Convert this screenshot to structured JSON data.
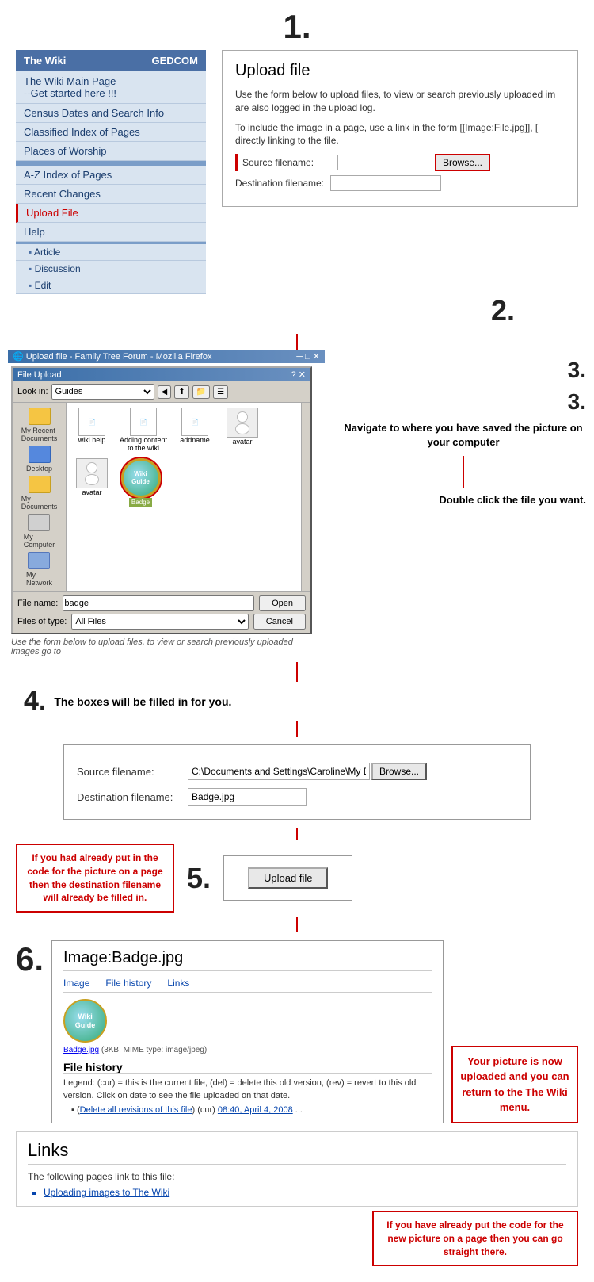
{
  "step1": {
    "number": "1.",
    "sidebar": {
      "header": {
        "wiki_label": "The Wiki",
        "gedcom_label": "GEDCOM"
      },
      "items": [
        {
          "label": "The Wiki Main Page\n--Get started here !!!",
          "type": "main"
        },
        {
          "label": "Census Dates and Search Info",
          "type": "item"
        },
        {
          "label": "Classified Index of Pages",
          "type": "item"
        },
        {
          "label": "Places of Worship",
          "type": "item"
        },
        {
          "label": "",
          "type": "sep"
        },
        {
          "label": "A-Z Index of Pages",
          "type": "item"
        },
        {
          "label": "Recent Changes",
          "type": "item"
        },
        {
          "label": "Upload File",
          "type": "item-upload"
        },
        {
          "label": "Help",
          "type": "item"
        },
        {
          "label": "",
          "type": "sep2"
        },
        {
          "label": "Article",
          "type": "sub"
        },
        {
          "label": "Discussion",
          "type": "sub"
        },
        {
          "label": "Edit",
          "type": "sub"
        }
      ]
    },
    "upload_panel": {
      "title": "Upload file",
      "para1": "Use the form below to upload files, to view or search previously uploaded im are also logged in the upload log.",
      "upload_log_link": "upload log",
      "para2": "To include the image in a page, use a link in the form [[Image:File.jpg]], [ directly linking to the file.",
      "source_label": "Source filename:",
      "dest_label": "Destination filename:",
      "browse_label": "Browse..."
    }
  },
  "step2": {
    "number": "2."
  },
  "step3": {
    "number": "3.",
    "instruction": "Navigate to where you have saved the picture on your computer",
    "dbl_click": "Double click the file you want.",
    "dialog": {
      "title": "Upload file - Family Tree Forum - Mozilla Firefox",
      "inner_title": "File Upload",
      "close": "✕",
      "min": "─",
      "max": "□",
      "look_in_label": "Look in:",
      "look_in_value": "Guides",
      "files": [
        {
          "name": "wiki help",
          "type": "doc"
        },
        {
          "name": "Adding content to the wiki",
          "type": "doc"
        },
        {
          "name": "addname",
          "type": "doc"
        },
        {
          "name": "avatar",
          "type": "img"
        },
        {
          "name": "avatar",
          "type": "img"
        },
        {
          "name": "badge",
          "type": "wiki-badge",
          "selected": true
        }
      ],
      "filename_label": "File name:",
      "filename_value": "badge",
      "filetype_label": "Files of type:",
      "filetype_value": "All Files",
      "open_btn": "Open",
      "cancel_btn": "Cancel",
      "sidebar_items": [
        "My Recent Documents",
        "Desktop",
        "My Documents",
        "My Computer",
        "My Network"
      ]
    },
    "below_text": "Use the form below to upload files, to view or search previously uploaded images go to"
  },
  "step4": {
    "number": "4.",
    "label": "The boxes will be filled in for you."
  },
  "form_filled": {
    "source_label": "Source filename:",
    "source_value": "C:\\Documents and Settings\\Caroline\\My Doc",
    "browse_label": "Browse...",
    "dest_label": "Destination filename:",
    "dest_value": "Badge.jpg"
  },
  "step5": {
    "number": "5.",
    "left_annot": "If you had already put in the code for the picture on a page then the destination filename will already be filled in.",
    "upload_btn": "Upload file"
  },
  "step6": {
    "number": "6.",
    "panel": {
      "title": "Image:Badge.jpg",
      "tabs": [
        "Image",
        "File history",
        "Links"
      ],
      "badge_link": "Badge.jpg",
      "badge_info": "(3KB, MIME type: image/jpeg)",
      "file_history_title": "File history",
      "legend": "Legend: (cur) = this is the current file, (del) = delete this old version, (rev) = revert to this old version. Click on date to see the file uploaded on that date.",
      "history_item": "▪ (Delete all revisions of this file) (cur) 08:40, April 4, 2008 . .",
      "delete_link": "Delete all revisions of this file",
      "date_link": "08:40, April 4, 2008"
    },
    "annot": "Your picture is now uploaded and  you can return to the The Wiki menu."
  },
  "links_section": {
    "title": "Links",
    "para": "The following pages link to this file:",
    "items": [
      {
        "label": "Uploading images to The Wiki"
      }
    ]
  },
  "bottom_annot": "If you have already put the code for the new picture on a page then you can go straight there."
}
